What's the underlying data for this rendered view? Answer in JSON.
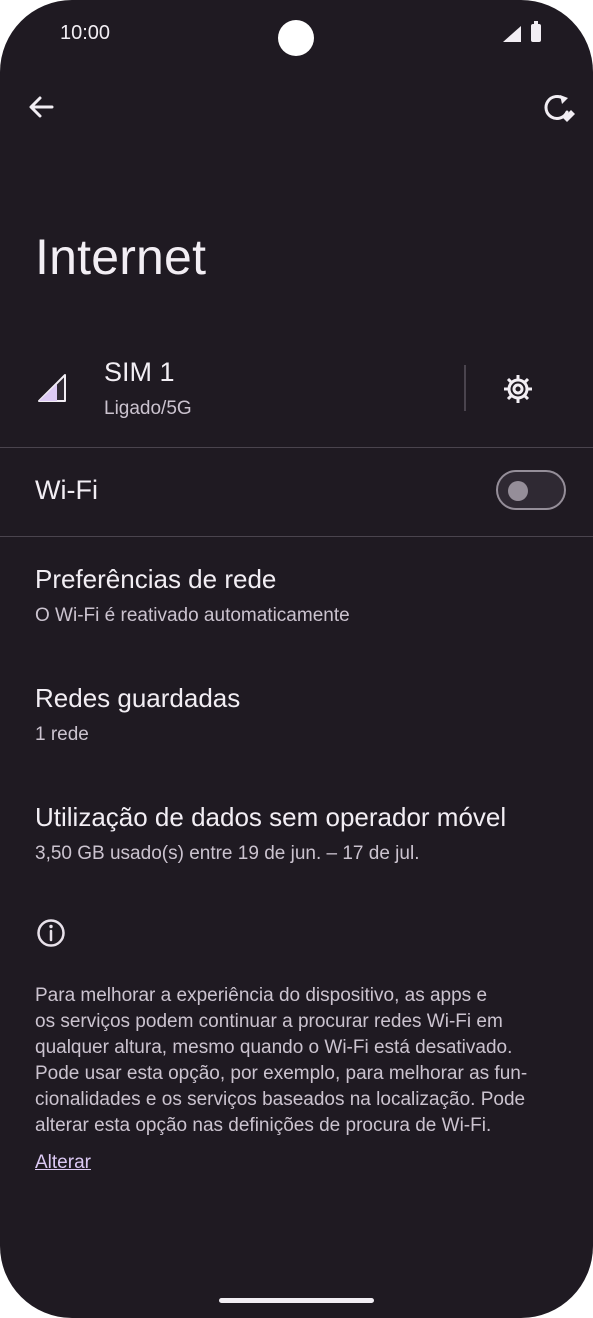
{
  "status_bar": {
    "time": "10:00"
  },
  "page": {
    "title": "Internet"
  },
  "sim": {
    "name": "SIM 1",
    "status": "Ligado/5G"
  },
  "wifi": {
    "label": "Wi-Fi",
    "enabled": false
  },
  "items": [
    {
      "title": "Preferências de rede",
      "subtitle": "O Wi-Fi é reativado automaticamente"
    },
    {
      "title": "Redes guardadas",
      "subtitle": "1 rede"
    },
    {
      "title": "Utilização de dados sem operador móvel",
      "subtitle": "3,50 GB usado(s) entre 19 de jun. – 17 de jul."
    }
  ],
  "info": {
    "lines": [
      "Para melhorar a experiência do dispositivo, as apps e",
      "os serviços podem continuar a procurar redes Wi-Fi em",
      "qualquer altura, mesmo quando o Wi-Fi está desativado.",
      "Pode usar esta opção, por exemplo, para melhorar as fun-",
      "cionalidades e os serviços baseados na localização. Pode",
      "alterar esta opção nas definições de procura de Wi-Fi."
    ],
    "link": "Alterar"
  },
  "colors": {
    "background": "#1f1a22",
    "accent": "#dcc9f4",
    "text": "#f2eef4",
    "subtext": "#cbc3cf"
  }
}
